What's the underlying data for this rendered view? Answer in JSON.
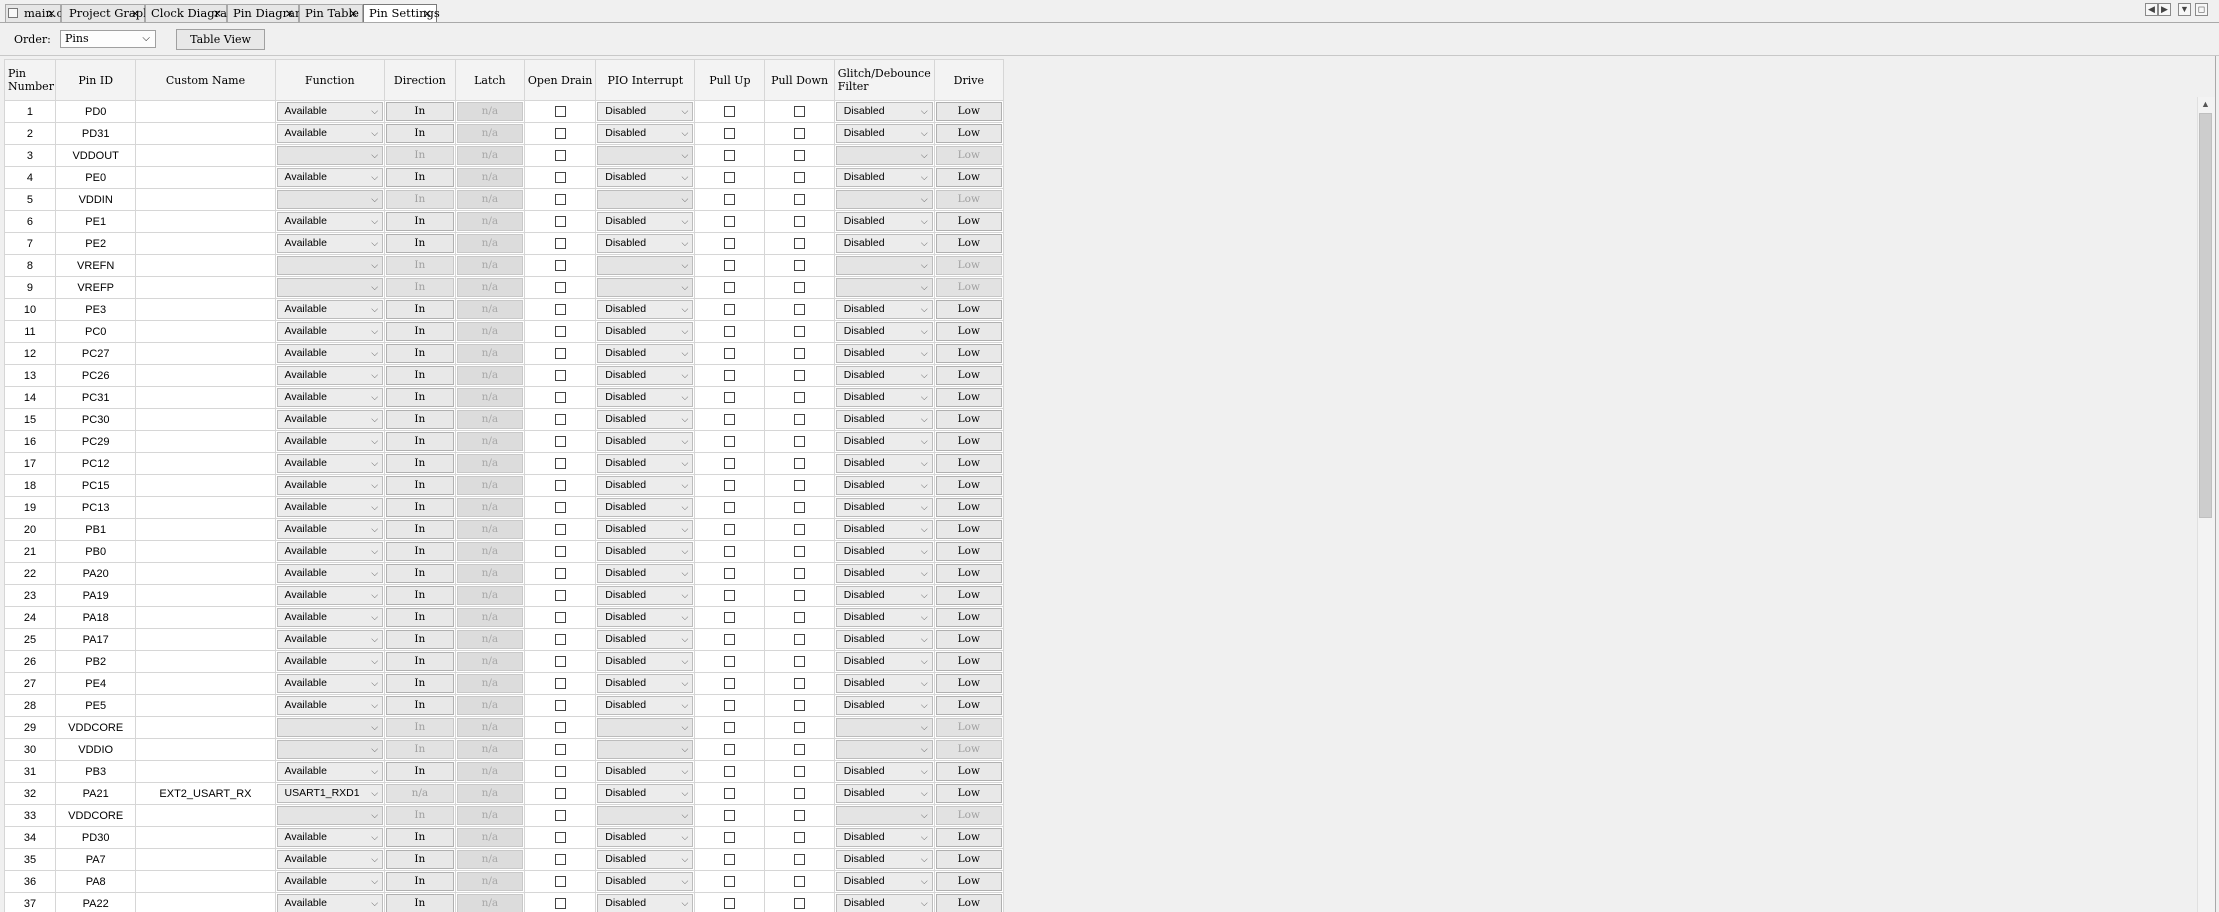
{
  "tabs": [
    {
      "label": "main.c"
    },
    {
      "label": "Project Graph"
    },
    {
      "label": "Clock Diagram"
    },
    {
      "label": "Pin Diagram"
    },
    {
      "label": "Pin Table"
    },
    {
      "label": "Pin Settings"
    }
  ],
  "active_tab": "Pin Settings",
  "close_glyph": "×",
  "window_buttons": [
    "◀",
    "▶",
    "▼",
    "◻"
  ],
  "toolbar": {
    "order_label": "Order:",
    "order_value": "Pins",
    "table_view_label": "Table View"
  },
  "columns": [
    "Pin Number",
    "Pin ID",
    "Custom Name",
    "Function",
    "Direction",
    "Latch",
    "Open Drain",
    "PIO Interrupt",
    "Pull Up",
    "Pull Down",
    "Glitch/Debounce Filter",
    "Drive"
  ],
  "rows": [
    {
      "num": "1",
      "id": "PD0",
      "name": "",
      "func": "Available",
      "dir": "In",
      "latch": "n/a",
      "irq": "Disabled",
      "filter": "Disabled",
      "drive": "Low",
      "power": false
    },
    {
      "num": "2",
      "id": "PD31",
      "name": "",
      "func": "Available",
      "dir": "In",
      "latch": "n/a",
      "irq": "Disabled",
      "filter": "Disabled",
      "drive": "Low",
      "power": false
    },
    {
      "num": "3",
      "id": "VDDOUT",
      "name": "",
      "func": "",
      "dir": "In",
      "latch": "n/a",
      "irq": "",
      "filter": "",
      "drive": "Low",
      "power": true
    },
    {
      "num": "4",
      "id": "PE0",
      "name": "",
      "func": "Available",
      "dir": "In",
      "latch": "n/a",
      "irq": "Disabled",
      "filter": "Disabled",
      "drive": "Low",
      "power": false
    },
    {
      "num": "5",
      "id": "VDDIN",
      "name": "",
      "func": "",
      "dir": "In",
      "latch": "n/a",
      "irq": "",
      "filter": "",
      "drive": "Low",
      "power": true
    },
    {
      "num": "6",
      "id": "PE1",
      "name": "",
      "func": "Available",
      "dir": "In",
      "latch": "n/a",
      "irq": "Disabled",
      "filter": "Disabled",
      "drive": "Low",
      "power": false
    },
    {
      "num": "7",
      "id": "PE2",
      "name": "",
      "func": "Available",
      "dir": "In",
      "latch": "n/a",
      "irq": "Disabled",
      "filter": "Disabled",
      "drive": "Low",
      "power": false
    },
    {
      "num": "8",
      "id": "VREFN",
      "name": "",
      "func": "",
      "dir": "In",
      "latch": "n/a",
      "irq": "",
      "filter": "",
      "drive": "Low",
      "power": true
    },
    {
      "num": "9",
      "id": "VREFP",
      "name": "",
      "func": "",
      "dir": "In",
      "latch": "n/a",
      "irq": "",
      "filter": "",
      "drive": "Low",
      "power": true
    },
    {
      "num": "10",
      "id": "PE3",
      "name": "",
      "func": "Available",
      "dir": "In",
      "latch": "n/a",
      "irq": "Disabled",
      "filter": "Disabled",
      "drive": "Low",
      "power": false
    },
    {
      "num": "11",
      "id": "PC0",
      "name": "",
      "func": "Available",
      "dir": "In",
      "latch": "n/a",
      "irq": "Disabled",
      "filter": "Disabled",
      "drive": "Low",
      "power": false
    },
    {
      "num": "12",
      "id": "PC27",
      "name": "",
      "func": "Available",
      "dir": "In",
      "latch": "n/a",
      "irq": "Disabled",
      "filter": "Disabled",
      "drive": "Low",
      "power": false
    },
    {
      "num": "13",
      "id": "PC26",
      "name": "",
      "func": "Available",
      "dir": "In",
      "latch": "n/a",
      "irq": "Disabled",
      "filter": "Disabled",
      "drive": "Low",
      "power": false
    },
    {
      "num": "14",
      "id": "PC31",
      "name": "",
      "func": "Available",
      "dir": "In",
      "latch": "n/a",
      "irq": "Disabled",
      "filter": "Disabled",
      "drive": "Low",
      "power": false
    },
    {
      "num": "15",
      "id": "PC30",
      "name": "",
      "func": "Available",
      "dir": "In",
      "latch": "n/a",
      "irq": "Disabled",
      "filter": "Disabled",
      "drive": "Low",
      "power": false
    },
    {
      "num": "16",
      "id": "PC29",
      "name": "",
      "func": "Available",
      "dir": "In",
      "latch": "n/a",
      "irq": "Disabled",
      "filter": "Disabled",
      "drive": "Low",
      "power": false
    },
    {
      "num": "17",
      "id": "PC12",
      "name": "",
      "func": "Available",
      "dir": "In",
      "latch": "n/a",
      "irq": "Disabled",
      "filter": "Disabled",
      "drive": "Low",
      "power": false
    },
    {
      "num": "18",
      "id": "PC15",
      "name": "",
      "func": "Available",
      "dir": "In",
      "latch": "n/a",
      "irq": "Disabled",
      "filter": "Disabled",
      "drive": "Low",
      "power": false
    },
    {
      "num": "19",
      "id": "PC13",
      "name": "",
      "func": "Available",
      "dir": "In",
      "latch": "n/a",
      "irq": "Disabled",
      "filter": "Disabled",
      "drive": "Low",
      "power": false
    },
    {
      "num": "20",
      "id": "PB1",
      "name": "",
      "func": "Available",
      "dir": "In",
      "latch": "n/a",
      "irq": "Disabled",
      "filter": "Disabled",
      "drive": "Low",
      "power": false
    },
    {
      "num": "21",
      "id": "PB0",
      "name": "",
      "func": "Available",
      "dir": "In",
      "latch": "n/a",
      "irq": "Disabled",
      "filter": "Disabled",
      "drive": "Low",
      "power": false
    },
    {
      "num": "22",
      "id": "PA20",
      "name": "",
      "func": "Available",
      "dir": "In",
      "latch": "n/a",
      "irq": "Disabled",
      "filter": "Disabled",
      "drive": "Low",
      "power": false
    },
    {
      "num": "23",
      "id": "PA19",
      "name": "",
      "func": "Available",
      "dir": "In",
      "latch": "n/a",
      "irq": "Disabled",
      "filter": "Disabled",
      "drive": "Low",
      "power": false
    },
    {
      "num": "24",
      "id": "PA18",
      "name": "",
      "func": "Available",
      "dir": "In",
      "latch": "n/a",
      "irq": "Disabled",
      "filter": "Disabled",
      "drive": "Low",
      "power": false
    },
    {
      "num": "25",
      "id": "PA17",
      "name": "",
      "func": "Available",
      "dir": "In",
      "latch": "n/a",
      "irq": "Disabled",
      "filter": "Disabled",
      "drive": "Low",
      "power": false
    },
    {
      "num": "26",
      "id": "PB2",
      "name": "",
      "func": "Available",
      "dir": "In",
      "latch": "n/a",
      "irq": "Disabled",
      "filter": "Disabled",
      "drive": "Low",
      "power": false
    },
    {
      "num": "27",
      "id": "PE4",
      "name": "",
      "func": "Available",
      "dir": "In",
      "latch": "n/a",
      "irq": "Disabled",
      "filter": "Disabled",
      "drive": "Low",
      "power": false
    },
    {
      "num": "28",
      "id": "PE5",
      "name": "",
      "func": "Available",
      "dir": "In",
      "latch": "n/a",
      "irq": "Disabled",
      "filter": "Disabled",
      "drive": "Low",
      "power": false
    },
    {
      "num": "29",
      "id": "VDDCORE",
      "name": "",
      "func": "",
      "dir": "In",
      "latch": "n/a",
      "irq": "",
      "filter": "",
      "drive": "Low",
      "power": true
    },
    {
      "num": "30",
      "id": "VDDIO",
      "name": "",
      "func": "",
      "dir": "In",
      "latch": "n/a",
      "irq": "",
      "filter": "",
      "drive": "Low",
      "power": true
    },
    {
      "num": "31",
      "id": "PB3",
      "name": "",
      "func": "Available",
      "dir": "In",
      "latch": "n/a",
      "irq": "Disabled",
      "filter": "Disabled",
      "drive": "Low",
      "power": false
    },
    {
      "num": "32",
      "id": "PA21",
      "name": "EXT2_USART_RX",
      "func": "USART1_RXD1",
      "dir": "n/a",
      "latch": "n/a",
      "irq": "Disabled",
      "filter": "Disabled",
      "drive": "Low",
      "power": false,
      "periph": true
    },
    {
      "num": "33",
      "id": "VDDCORE",
      "name": "",
      "func": "",
      "dir": "In",
      "latch": "n/a",
      "irq": "",
      "filter": "",
      "drive": "Low",
      "power": true
    },
    {
      "num": "34",
      "id": "PD30",
      "name": "",
      "func": "Available",
      "dir": "In",
      "latch": "n/a",
      "irq": "Disabled",
      "filter": "Disabled",
      "drive": "Low",
      "power": false
    },
    {
      "num": "35",
      "id": "PA7",
      "name": "",
      "func": "Available",
      "dir": "In",
      "latch": "n/a",
      "irq": "Disabled",
      "filter": "Disabled",
      "drive": "Low",
      "power": false
    },
    {
      "num": "36",
      "id": "PA8",
      "name": "",
      "func": "Available",
      "dir": "In",
      "latch": "n/a",
      "irq": "Disabled",
      "filter": "Disabled",
      "drive": "Low",
      "power": false
    },
    {
      "num": "37",
      "id": "PA22",
      "name": "",
      "func": "Available",
      "dir": "In",
      "latch": "n/a",
      "irq": "Disabled",
      "filter": "Disabled",
      "drive": "Low",
      "power": false
    }
  ],
  "glyphs": {
    "chevron": "⌵",
    "scroll_up": "▲"
  }
}
